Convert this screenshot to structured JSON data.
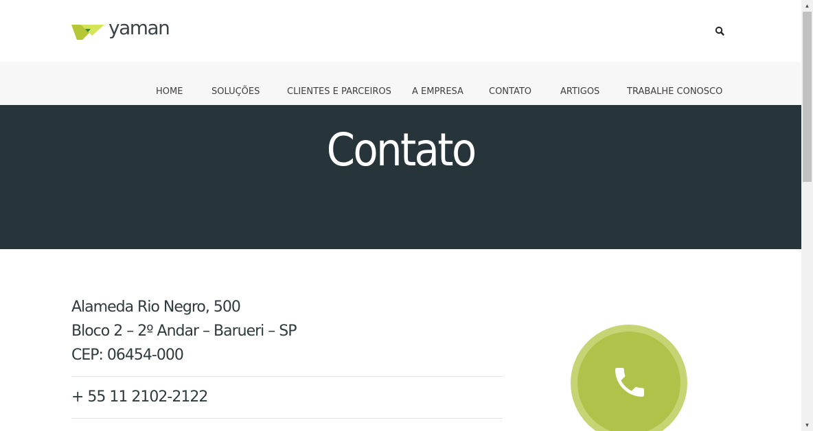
{
  "brand": {
    "name": "yaman",
    "logo_colors": [
      "#b5c636",
      "#d6e45a",
      "#3c8a3a"
    ]
  },
  "header": {
    "search_icon": "search-icon"
  },
  "nav": {
    "items": [
      {
        "label": "HOME"
      },
      {
        "label": "SOLUÇÕES"
      },
      {
        "label": "CLIENTES E PARCEIROS"
      },
      {
        "label": "A EMPRESA"
      },
      {
        "label": "CONTATO"
      },
      {
        "label": "ARTIGOS"
      },
      {
        "label": "TRABALHE CONOSCO"
      }
    ]
  },
  "hero": {
    "title": "Contato",
    "background": "#27353a"
  },
  "contact": {
    "address_lines": [
      "Alameda Rio Negro, 500",
      "Bloco 2 – 2º Andar – Barueri – SP",
      "CEP: 06454-000"
    ],
    "phone": "+ 55 11 2102-2122",
    "phone_icon": "phone-icon",
    "accent_color": "#b1c24a"
  }
}
